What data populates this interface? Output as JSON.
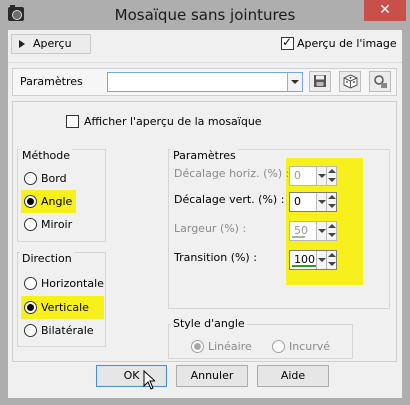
{
  "window": {
    "title": "Mosaïque sans jointures",
    "close_glyph": "✕"
  },
  "top": {
    "apercu_label": "Aperçu",
    "apercu_image_label": "Aperçu de l'image",
    "apercu_image_checked": true
  },
  "presets": {
    "label": "Paramètres",
    "value": ""
  },
  "mosaic": {
    "show_preview_label": "Afficher l'aperçu de la mosaïque",
    "show_preview_checked": false
  },
  "method": {
    "title": "Méthode",
    "options": [
      "Bord",
      "Angle",
      "Miroir"
    ],
    "selected": "Angle"
  },
  "direction": {
    "title": "Direction",
    "options": [
      "Horizontale",
      "Verticale",
      "Bilatérale"
    ],
    "selected": "Verticale"
  },
  "parameters": {
    "title": "Paramètres",
    "fields": [
      {
        "label": "Décalage horiz. (%) :",
        "value": "0",
        "enabled": false
      },
      {
        "label": "Décalage vert. (%) :",
        "value": "0",
        "enabled": true
      },
      {
        "label": "Largeur (%) :",
        "value": "50",
        "enabled": false
      },
      {
        "label": "Transition (%) :",
        "value": "100",
        "enabled": true
      }
    ]
  },
  "angle_style": {
    "title": "Style d'angle",
    "options": [
      "Linéaire",
      "Incurvé"
    ],
    "selected": "Linéaire",
    "enabled": false
  },
  "buttons": {
    "ok": "OK",
    "cancel": "Annuler",
    "help": "Aide"
  },
  "colors": {
    "highlight": "#f7f01c",
    "close_button": "#c7504b",
    "title_bar": "#aeaeae"
  }
}
